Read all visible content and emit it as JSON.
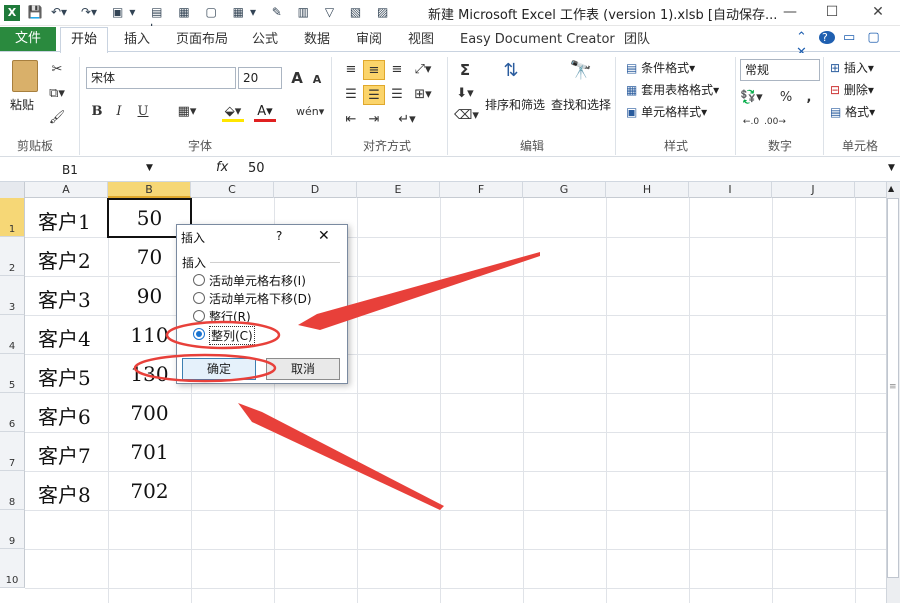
{
  "window": {
    "title": "新建 Microsoft Excel 工作表 (version 1).xlsb [自动保存..."
  },
  "tabs": {
    "file": "文件",
    "home": "开始",
    "insert": "插入",
    "layout": "页面布局",
    "formula": "公式",
    "data": "数据",
    "review": "审阅",
    "view": "视图",
    "easydoc": "Easy Document Creator",
    "team": "团队"
  },
  "ribbon": {
    "clipboard": {
      "paste": "粘贴",
      "label": "剪贴板"
    },
    "font": {
      "name": "宋体",
      "size": "20",
      "label": "字体",
      "bold": "B",
      "italic": "I",
      "underline": "U",
      "grow": "A",
      "shrink": "A"
    },
    "align": {
      "label": "对齐方式"
    },
    "edit": {
      "sort": "排序和筛选",
      "find": "查找和选择",
      "label": "编辑",
      "sigma": "Σ"
    },
    "styles": {
      "cond": "条件格式",
      "table": "套用表格格式",
      "cell": "单元格样式",
      "label": "样式"
    },
    "number": {
      "format": "常规",
      "label": "数字",
      "percent": "%",
      "comma": ","
    },
    "cells": {
      "insert": "插入",
      "delete": "删除",
      "format": "格式",
      "label": "单元格"
    }
  },
  "formula": {
    "namebox": "B1",
    "fx": "fx",
    "value": "50"
  },
  "columns": [
    "A",
    "B",
    "C",
    "D",
    "E",
    "F",
    "G",
    "H",
    "I",
    "J"
  ],
  "rows": [
    "1",
    "2",
    "3",
    "4",
    "5",
    "6",
    "7",
    "8",
    "9",
    "10"
  ],
  "cells": {
    "a": [
      "客户1",
      "客户2",
      "客户3",
      "客户4",
      "客户5",
      "客户6",
      "客户7",
      "客户8"
    ],
    "b": [
      "50",
      "70",
      "90",
      "110",
      "130",
      "700",
      "701",
      "702"
    ]
  },
  "dialog": {
    "title": "插入",
    "help": "?",
    "close": "✕",
    "group": "插入",
    "opt1": "活动单元格右移(I)",
    "opt2": "活动单元格下移(D)",
    "opt3": "整行(R)",
    "opt4": "整列(C)",
    "ok": "确定",
    "cancel": "取消"
  },
  "colors": {
    "accent": "#2a8a3e",
    "annotation": "#e8403a",
    "selected_col": "#f6d776"
  }
}
